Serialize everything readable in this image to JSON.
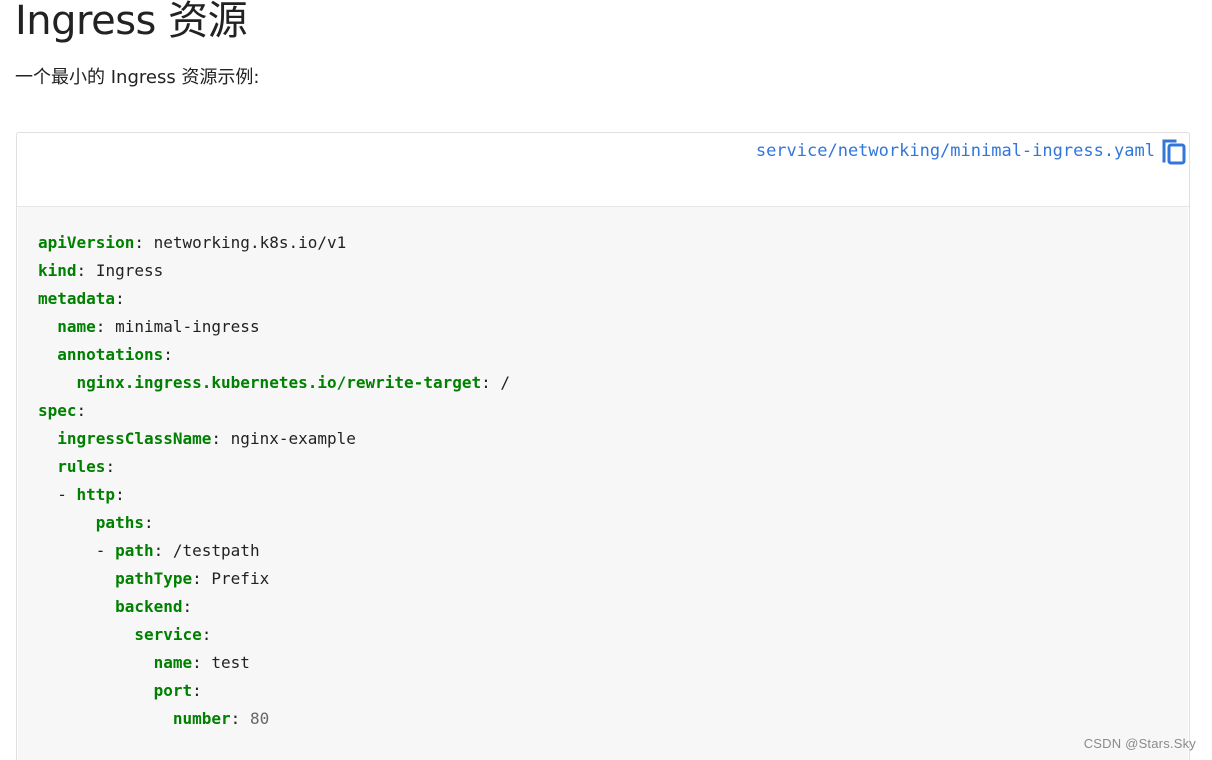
{
  "heading": "Ingress 资源",
  "intro": "一个最小的 Ingress 资源示例:",
  "file": {
    "path": "service/networking/minimal-ingress.yaml",
    "copy_icon": "copy-icon"
  },
  "code_lines": [
    {
      "indent": "",
      "dash": "",
      "key": "apiVersion",
      "value": "networking.k8s.io/v1",
      "value_type": "text"
    },
    {
      "indent": "",
      "dash": "",
      "key": "kind",
      "value": "Ingress",
      "value_type": "text"
    },
    {
      "indent": "",
      "dash": "",
      "key": "metadata",
      "value": "",
      "value_type": "text"
    },
    {
      "indent": "  ",
      "dash": "",
      "key": "name",
      "value": "minimal-ingress",
      "value_type": "text"
    },
    {
      "indent": "  ",
      "dash": "",
      "key": "annotations",
      "value": "",
      "value_type": "text"
    },
    {
      "indent": "    ",
      "dash": "",
      "key": "nginx.ingress.kubernetes.io/rewrite-target",
      "value": "/",
      "value_type": "text"
    },
    {
      "indent": "",
      "dash": "",
      "key": "spec",
      "value": "",
      "value_type": "text"
    },
    {
      "indent": "  ",
      "dash": "",
      "key": "ingressClassName",
      "value": "nginx-example",
      "value_type": "text"
    },
    {
      "indent": "  ",
      "dash": "",
      "key": "rules",
      "value": "",
      "value_type": "text"
    },
    {
      "indent": "  ",
      "dash": "- ",
      "key": "http",
      "value": "",
      "value_type": "text"
    },
    {
      "indent": "      ",
      "dash": "",
      "key": "paths",
      "value": "",
      "value_type": "text"
    },
    {
      "indent": "      ",
      "dash": "- ",
      "key": "path",
      "value": "/testpath",
      "value_type": "text"
    },
    {
      "indent": "        ",
      "dash": "",
      "key": "pathType",
      "value": "Prefix",
      "value_type": "text"
    },
    {
      "indent": "        ",
      "dash": "",
      "key": "backend",
      "value": "",
      "value_type": "text"
    },
    {
      "indent": "          ",
      "dash": "",
      "key": "service",
      "value": "",
      "value_type": "text"
    },
    {
      "indent": "            ",
      "dash": "",
      "key": "name",
      "value": "test",
      "value_type": "text"
    },
    {
      "indent": "            ",
      "dash": "",
      "key": "port",
      "value": "",
      "value_type": "text"
    },
    {
      "indent": "              ",
      "dash": "",
      "key": "number",
      "value": "80",
      "value_type": "number"
    }
  ],
  "colors": {
    "yaml_key": "#008000",
    "link": "#3176d9",
    "code_background": "#f7f7f7",
    "number": "#666666"
  },
  "watermark": "CSDN @Stars.Sky"
}
